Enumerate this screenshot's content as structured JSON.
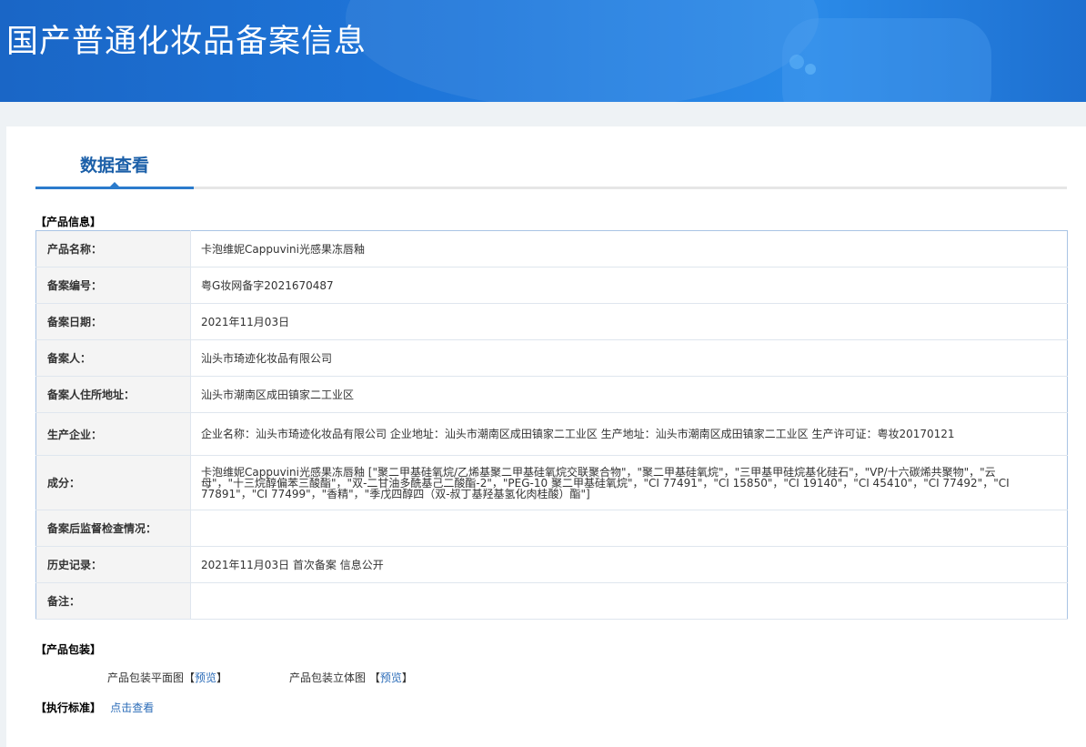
{
  "header": {
    "title": "国产普通化妆品备案信息"
  },
  "tab": {
    "label": "数据查看"
  },
  "product_info": {
    "section_title": "【产品信息】",
    "rows": [
      {
        "key": "产品名称：",
        "value": "卡泡维妮Cappuvini光感果冻唇釉"
      },
      {
        "key": "备案编号：",
        "value": "粤G妆网备字2021670487"
      },
      {
        "key": "备案日期：",
        "value": "2021年11月03日"
      },
      {
        "key": "备案人：",
        "value": "汕头市琦迹化妆品有限公司"
      },
      {
        "key": "备案人住所地址：",
        "value": "汕头市潮南区成田镇家二工业区"
      },
      {
        "key": "生产企业：",
        "value": "企业名称：汕头市琦迹化妆品有限公司 企业地址：汕头市潮南区成田镇家二工业区 生产地址：汕头市潮南区成田镇家二工业区 生产许可证：粤妆20170121"
      },
      {
        "key": "成分：",
        "value": "卡泡维妮Cappuvini光感果冻唇釉 [\"聚二甲基硅氧烷/乙烯基聚二甲基硅氧烷交联聚合物\"，\"聚二甲基硅氧烷\"，\"三甲基甲硅烷基化硅石\"，\"VP/十六碳烯共聚物\"，\"云母\"，\"十三烷醇偏苯三酸酯\"，\"双-二甘油多酰基己二酸酯-2\"，\"PEG-10 聚二甲基硅氧烷\"，\"CI 77491\"，\"CI 15850\"，\"CI 19140\"，\"CI 45410\"，\"CI 77492\"，\"CI 77891\"，\"CI 77499\"，\"香精\"，\"季戊四醇四（双-叔丁基羟基氢化肉桂酸）酯\"]"
      },
      {
        "key": "备案后监督检查情况：",
        "value": ""
      },
      {
        "key": "历史记录：",
        "value": "2021年11月03日 首次备案 信息公开"
      },
      {
        "key": "备注：",
        "value": ""
      }
    ]
  },
  "packaging": {
    "section_title": "【产品包装】",
    "flat_label": "产品包装平面图【",
    "flat_link": "预览",
    "flat_close": "】",
    "solid_label": "产品包装立体图 【",
    "solid_link": "预览",
    "solid_close": "】"
  },
  "standard": {
    "section_title": "【执行标准】",
    "link": "点击查看"
  }
}
